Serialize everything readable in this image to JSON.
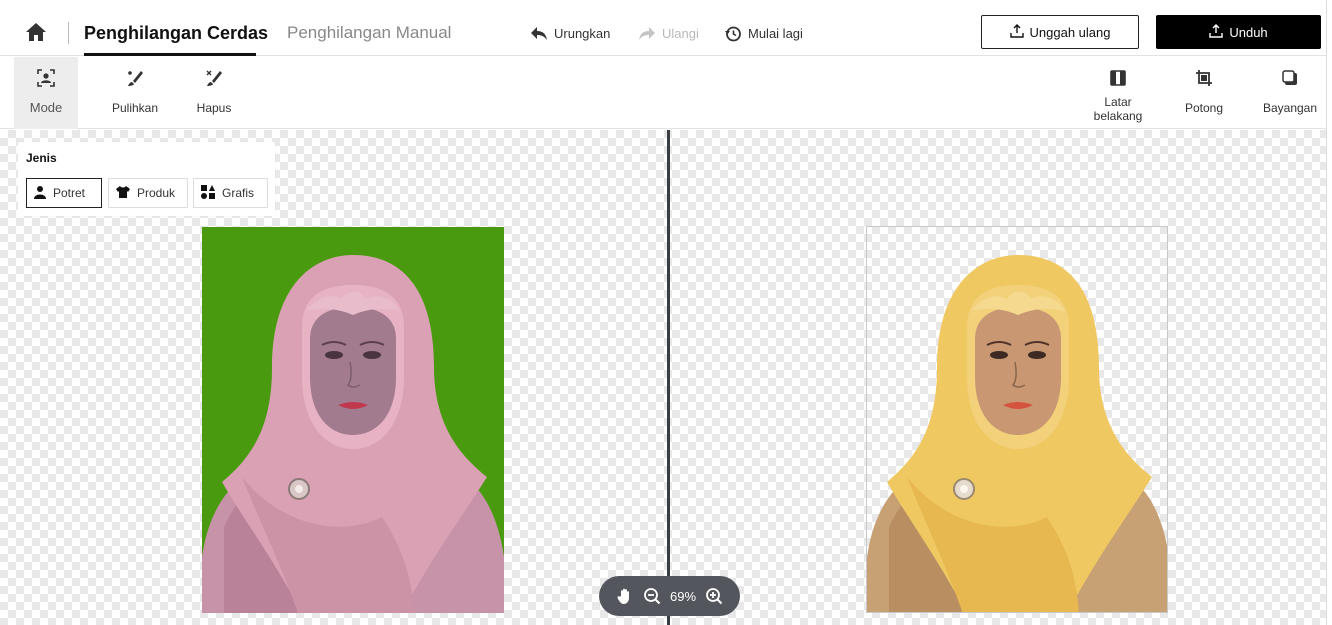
{
  "header": {
    "home_icon": "home-icon",
    "tabs": [
      {
        "label": "Penghilangan Cerdas",
        "active": true
      },
      {
        "label": "Penghilangan Manual",
        "active": false
      }
    ],
    "actions": {
      "undo": "Urungkan",
      "redo": "Ulangi",
      "reset": "Mulai lagi"
    },
    "reupload_label": "Unggah ulang",
    "download_label": "Unduh"
  },
  "toolbar": {
    "left": [
      {
        "label": "Mode",
        "icon": "mode-icon"
      },
      {
        "label": "Pulihkan",
        "icon": "restore-brush-icon"
      },
      {
        "label": "Hapus",
        "icon": "erase-brush-icon"
      }
    ],
    "right": [
      {
        "label": "Latar belakang",
        "icon": "background-icon"
      },
      {
        "label": "Potong",
        "icon": "crop-icon"
      },
      {
        "label": "Bayangan",
        "icon": "shadow-icon"
      }
    ]
  },
  "type_panel": {
    "title": "Jenis",
    "options": [
      {
        "label": "Potret",
        "icon": "portrait-icon",
        "selected": true
      },
      {
        "label": "Produk",
        "icon": "shirt-icon",
        "selected": false
      },
      {
        "label": "Grafis",
        "icon": "graphic-icon",
        "selected": false
      }
    ]
  },
  "zoom": {
    "level": "69%"
  },
  "colors": {
    "original_background": "#4a9a0f",
    "download_button": "#000000",
    "zoom_pill": "#54565e",
    "divider": "#3b3d45"
  }
}
